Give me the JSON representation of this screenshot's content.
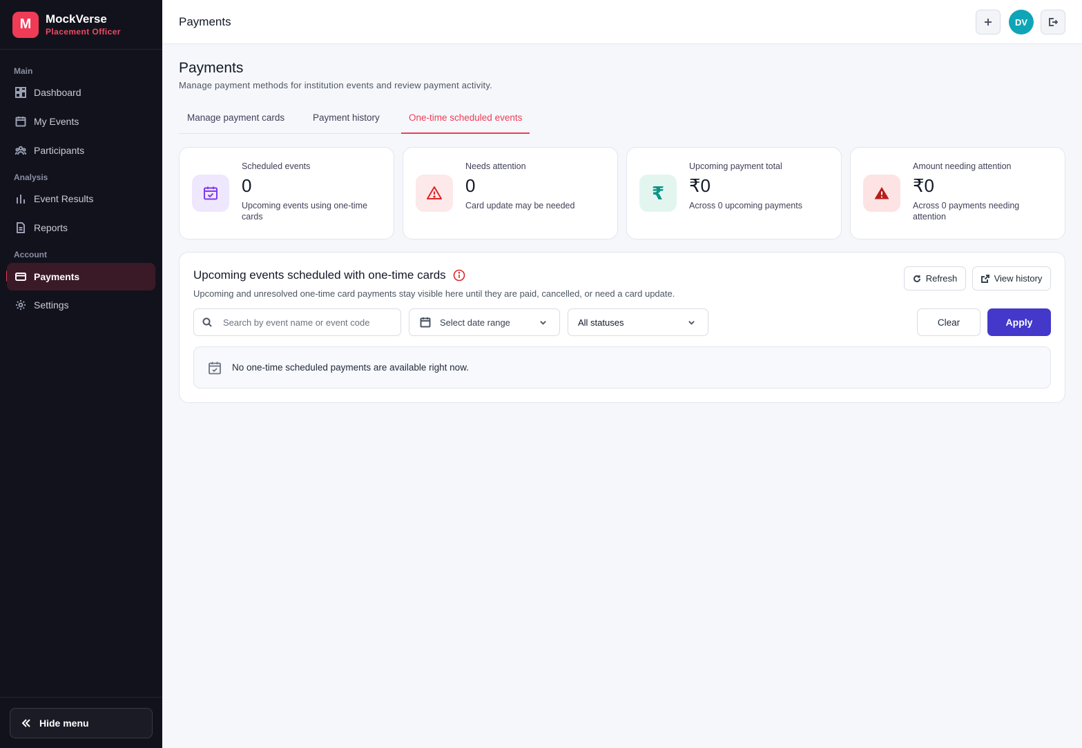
{
  "brand": {
    "logo_letter": "M",
    "name": "MockVerse",
    "role": "Placement Officer"
  },
  "sidebar": {
    "sections": [
      "Main",
      "Analysis",
      "Account"
    ],
    "items": [
      {
        "label": "Dashboard",
        "icon": "dashboard-icon"
      },
      {
        "label": "My Events",
        "icon": "calendar-icon"
      },
      {
        "label": "Participants",
        "icon": "users-icon"
      },
      {
        "label": "Event Results",
        "icon": "bar-chart-icon"
      },
      {
        "label": "Reports",
        "icon": "document-icon"
      },
      {
        "label": "Payments",
        "icon": "credit-card-icon",
        "active": true
      },
      {
        "label": "Settings",
        "icon": "gear-icon"
      }
    ],
    "hide_menu": "Hide menu"
  },
  "topbar": {
    "title": "Payments",
    "avatar_initials": "DV"
  },
  "page": {
    "title": "Payments",
    "subtitle": "Manage payment methods for institution events and review payment activity."
  },
  "tabs": [
    {
      "label": "Manage payment cards"
    },
    {
      "label": "Payment history"
    },
    {
      "label": "One-time scheduled events",
      "active": true
    }
  ],
  "stats": [
    {
      "label": "Scheduled events",
      "value": "0",
      "desc": "Upcoming events using one-time cards",
      "icon": "calendar-check-icon",
      "color": "#7c3aed",
      "bg": "#efe7fd"
    },
    {
      "label": "Needs attention",
      "value": "0",
      "desc": "Card update may be needed",
      "icon": "warning-outline-icon",
      "color": "#dc2626",
      "bg": "#fde8ea"
    },
    {
      "label": "Upcoming payment total",
      "value": "₹0",
      "desc": "Across 0 upcoming payments",
      "icon": "rupee-icon",
      "color": "#0d9488",
      "bg": "#e2f6ef"
    },
    {
      "label": "Amount needing attention",
      "value": "₹0",
      "desc": "Across 0 payments needing attention",
      "icon": "warning-filled-icon",
      "color": "#b91c1c",
      "bg": "#fde3e3"
    }
  ],
  "panel": {
    "title": "Upcoming events scheduled with one-time cards",
    "subtitle": "Upcoming and unresolved one-time card payments stay visible here until they are paid, cancelled, or need a card update.",
    "refresh": "Refresh",
    "view_history": "View history",
    "search_placeholder": "Search by event name or event code",
    "date_range": "Select date range",
    "status": "All statuses",
    "clear": "Clear",
    "apply": "Apply",
    "empty": "No one-time scheduled payments are available right now."
  },
  "colors": {
    "accent": "#ef3b56",
    "primary": "#4338ca",
    "sidebar_bg": "#12121c"
  }
}
